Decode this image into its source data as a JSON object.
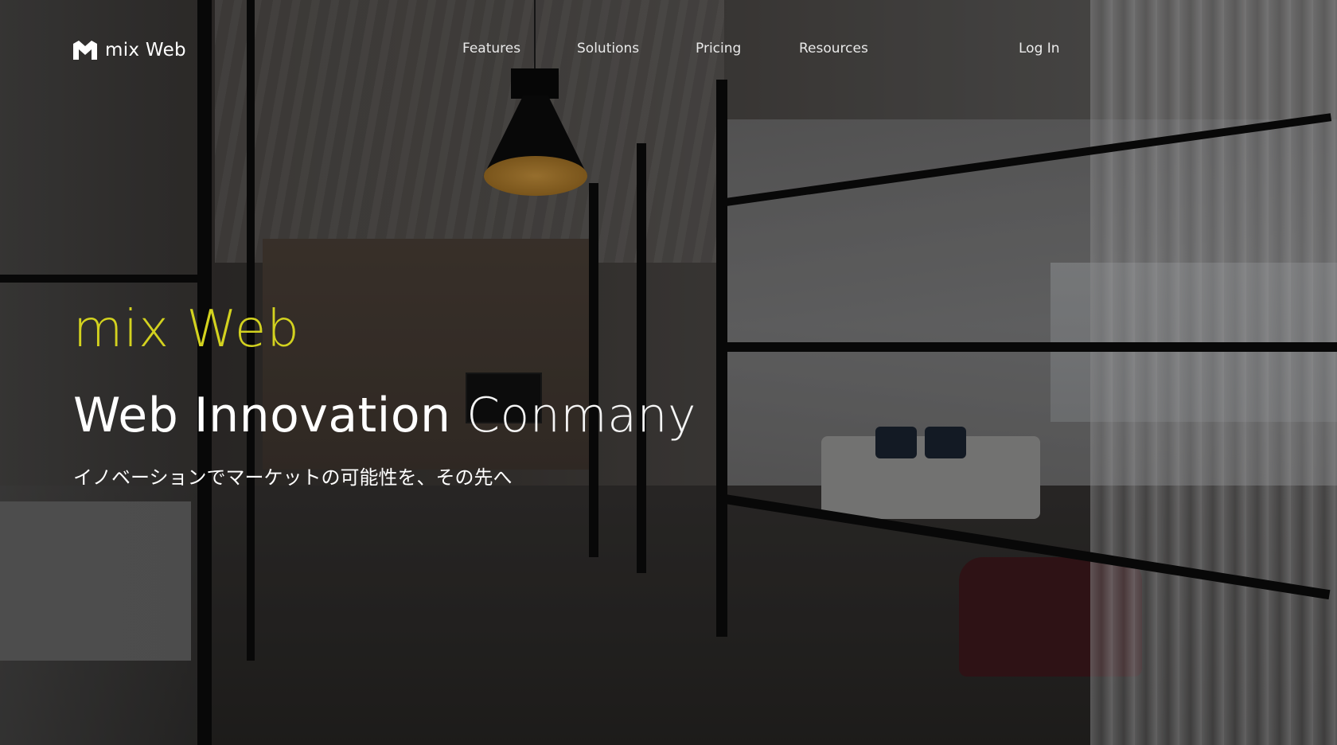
{
  "brand": {
    "name": "mix Web",
    "logo_icon": "m-logo-icon"
  },
  "nav": {
    "items": [
      {
        "label": "Features"
      },
      {
        "label": "Solutions"
      },
      {
        "label": "Pricing"
      },
      {
        "label": "Resources"
      }
    ],
    "login_label": "Log In"
  },
  "hero": {
    "brand_title": "mix Web",
    "headline_part1": "Web Innovation",
    "headline_part2": "Conmany",
    "subtitle": "イノベーションでマーケットの可能性を、その先へ"
  },
  "colors": {
    "brand_accent": "#d3d21f",
    "text": "#ffffff"
  }
}
